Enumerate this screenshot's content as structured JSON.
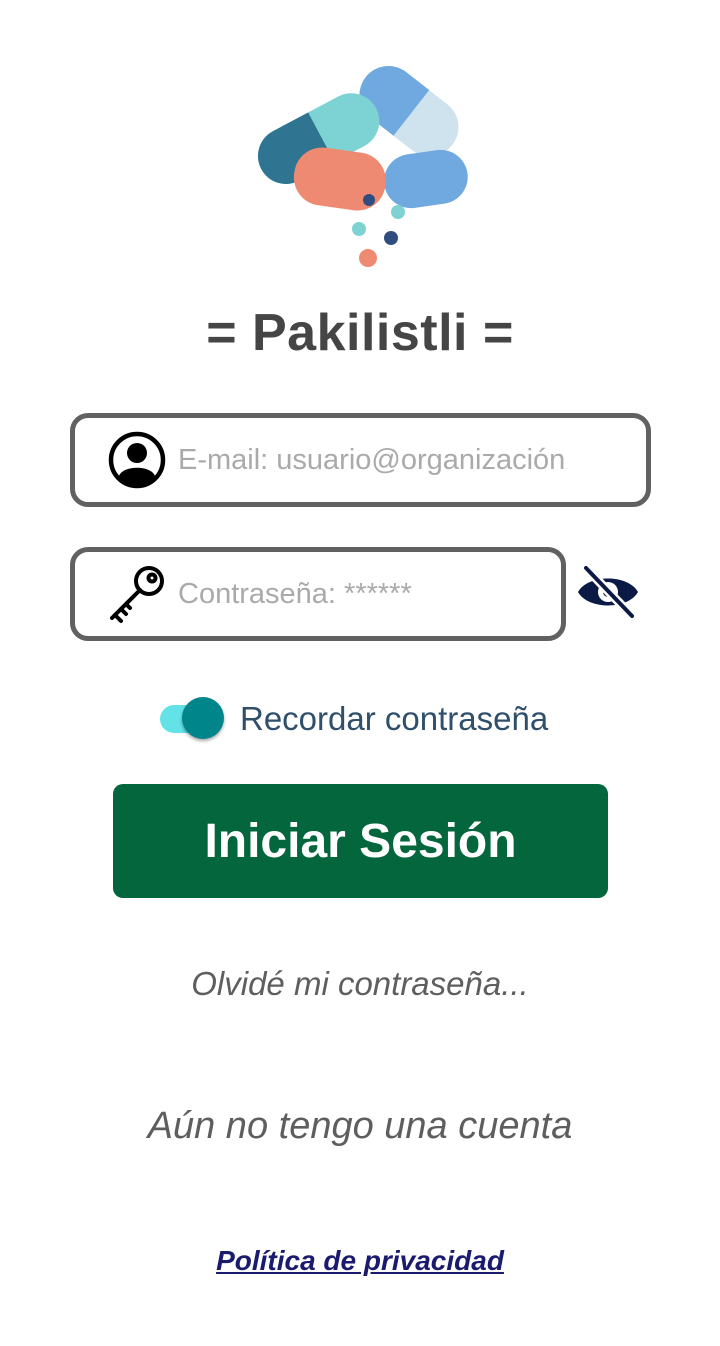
{
  "app": {
    "title": "= Pakilistli ="
  },
  "login_form": {
    "email": {
      "placeholder": "E-mail: usuario@organización",
      "value": "",
      "icon": "user-circle-icon"
    },
    "password": {
      "placeholder": "Contraseña: ******",
      "value": "",
      "icon": "key-icon"
    },
    "password_visibility": {
      "icon": "eye-off-icon",
      "visible": false
    },
    "remember": {
      "label": "Recordar contraseña",
      "checked": true
    },
    "submit_label": "Iniciar Sesión"
  },
  "links": {
    "forgot_password": "Olvidé mi contraseña...",
    "no_account": "Aún no tengo una cuenta",
    "privacy_policy": "Política de privacidad"
  },
  "colors": {
    "primary_button": "#03663c",
    "switch_thumb": "#00868a",
    "switch_track": "#63e3e8",
    "eye_icon": "#0b1a45",
    "link_color": "#1a1a6e",
    "field_border": "#616161"
  }
}
